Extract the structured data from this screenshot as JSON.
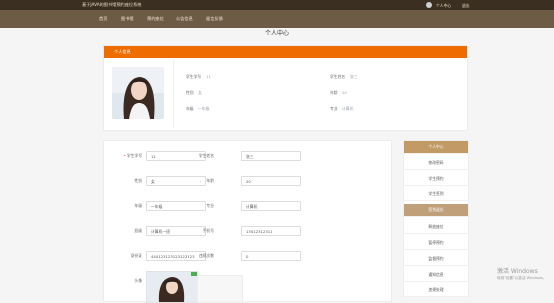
{
  "app": {
    "title": "基于JAVA的图书馆预约座位系统",
    "user_center": "个人中心",
    "logout": "退出"
  },
  "nav": [
    "首页",
    "图书馆",
    "预约座位",
    "公告信息",
    "留言反馈"
  ],
  "page_title": "个人中心",
  "profile": {
    "header": "个人信息",
    "fields": [
      {
        "label": "学生学号",
        "value": "11"
      },
      {
        "label": "学生姓名",
        "value": "张三"
      },
      {
        "label": "性别",
        "value": "女"
      },
      {
        "label": "年龄",
        "value": "20"
      },
      {
        "label": "年级",
        "value": "一年级"
      },
      {
        "label": "专业",
        "value": "计算机"
      }
    ]
  },
  "form": {
    "student_id": {
      "label": "学生学号",
      "value": "11"
    },
    "student_name": {
      "label": "学生姓名",
      "value": "张三"
    },
    "gender": {
      "label": "性别",
      "value": "女"
    },
    "age": {
      "label": "年龄",
      "value": "20"
    },
    "grade": {
      "label": "年级",
      "value": "一年级"
    },
    "major": {
      "label": "专业",
      "value": "计算机"
    },
    "class": {
      "label": "班级",
      "value": "计算机一班"
    },
    "phone": {
      "label": "手机号",
      "value": "13012312311"
    },
    "id_card": {
      "label": "身份证",
      "value": "440123123123123123"
    },
    "violations": {
      "label": "违规次数",
      "value": "0"
    },
    "avatar": {
      "label": "头像"
    }
  },
  "sidebar": {
    "header": "个人中心",
    "items": [
      "修改密码",
      "学生预约",
      "学生签到",
      "签到退出",
      "释放座位",
      "暂停预约",
      "监督预约",
      "通知信息",
      "违规处理"
    ]
  },
  "watermark": {
    "line1": "激活 Windows",
    "line2": "转到\"设置\"以激活 Windows。"
  }
}
